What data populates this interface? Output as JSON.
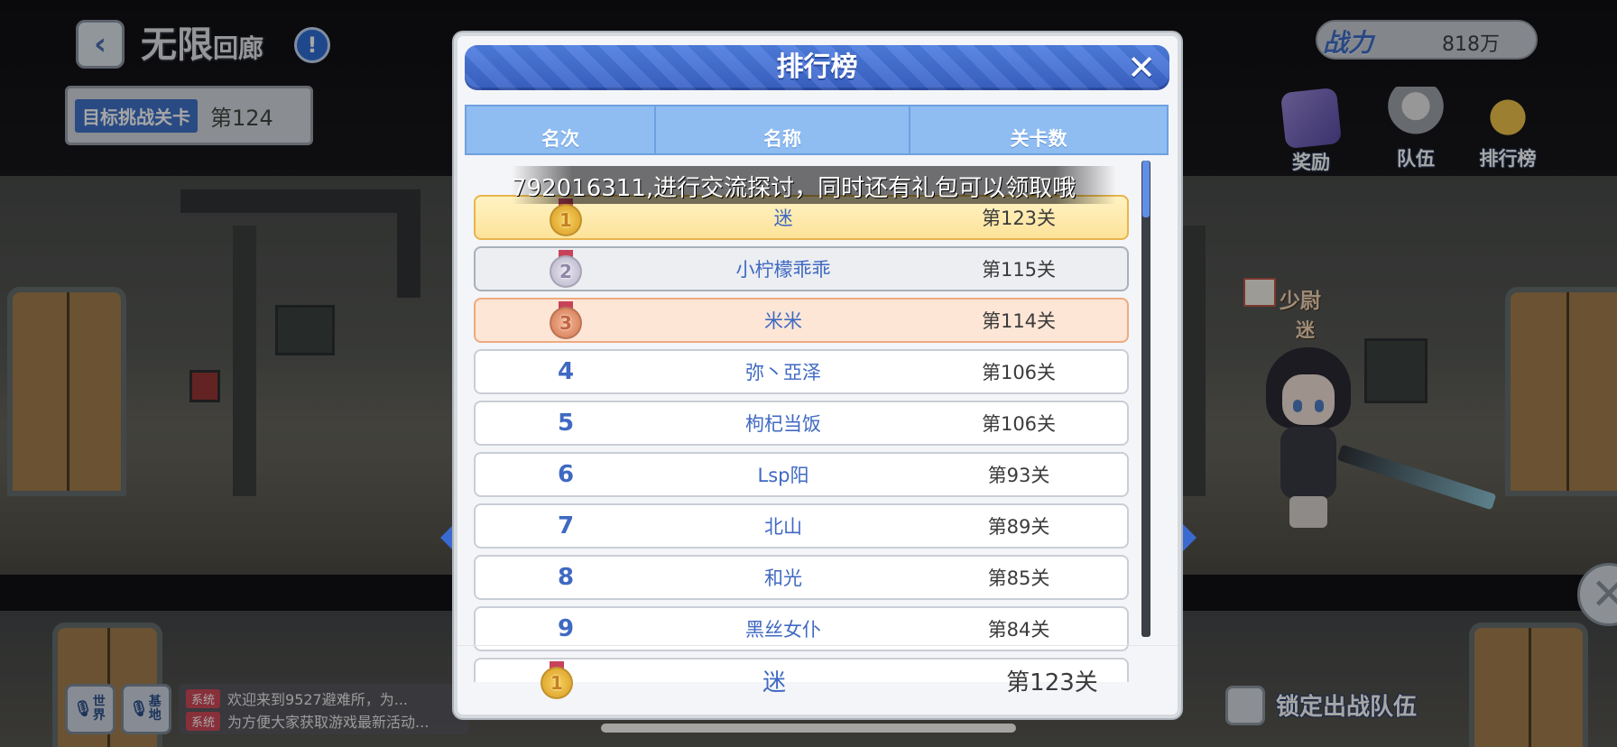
{
  "hud": {
    "mode_title_big": "无限",
    "mode_title_small": "回廊",
    "back_icon": "chevron-left-icon",
    "info_icon": "exclamation-icon",
    "info_glyph": "!",
    "target_label": "目标挑战关卡",
    "target_value": "第124",
    "power_label": "战力",
    "power_value": "818万",
    "buttons": [
      {
        "label": "奖励",
        "icon": "treasure-chest-icon"
      },
      {
        "label": "队伍",
        "icon": "team-icon"
      },
      {
        "label": "排行榜",
        "icon": "medal-icon"
      }
    ],
    "player_rank": "少尉",
    "player_name": "迷"
  },
  "bottom": {
    "voice_world": "世界",
    "voice_base": "基地",
    "chat": [
      {
        "tag": "系统",
        "text": "欢迎来到9527避难所，为..."
      },
      {
        "tag": "系统",
        "text": "为方便大家获取游戏最新活动..."
      }
    ],
    "lock_label": "锁定出战队伍"
  },
  "modal": {
    "title": "排行榜",
    "close_glyph": "✕",
    "columns": [
      "名次",
      "名称",
      "关卡数"
    ],
    "marquee": "792016311,进行交流探讨，同时还有礼包可以领取哦",
    "rows": [
      {
        "rank": "1",
        "name": "迷",
        "stage": "第123关",
        "medal": "gold"
      },
      {
        "rank": "2",
        "name": "小柠檬乖乖",
        "stage": "第115关",
        "medal": "silver"
      },
      {
        "rank": "3",
        "name": "米米",
        "stage": "第114关",
        "medal": "bronze"
      },
      {
        "rank": "4",
        "name": "弥丶亞泽",
        "stage": "第106关"
      },
      {
        "rank": "5",
        "name": "枸杞当饭",
        "stage": "第106关"
      },
      {
        "rank": "6",
        "name": "Lsp阳",
        "stage": "第93关"
      },
      {
        "rank": "7",
        "name": "北山",
        "stage": "第89关"
      },
      {
        "rank": "8",
        "name": "和光",
        "stage": "第85关"
      },
      {
        "rank": "9",
        "name": "黑丝女仆",
        "stage": "第84关"
      }
    ],
    "self": {
      "rank": "1",
      "name": "迷",
      "stage": "第123关",
      "medal": "gold"
    },
    "scroll_position": 0.0,
    "scroll_visible_fraction": 0.12
  },
  "colors": {
    "accent_blue": "#3f69c2",
    "header_blue": "#4f7ee0",
    "gold": "#f7d35f",
    "silver": "#b7b2c9",
    "bronze": "#d3764f"
  }
}
